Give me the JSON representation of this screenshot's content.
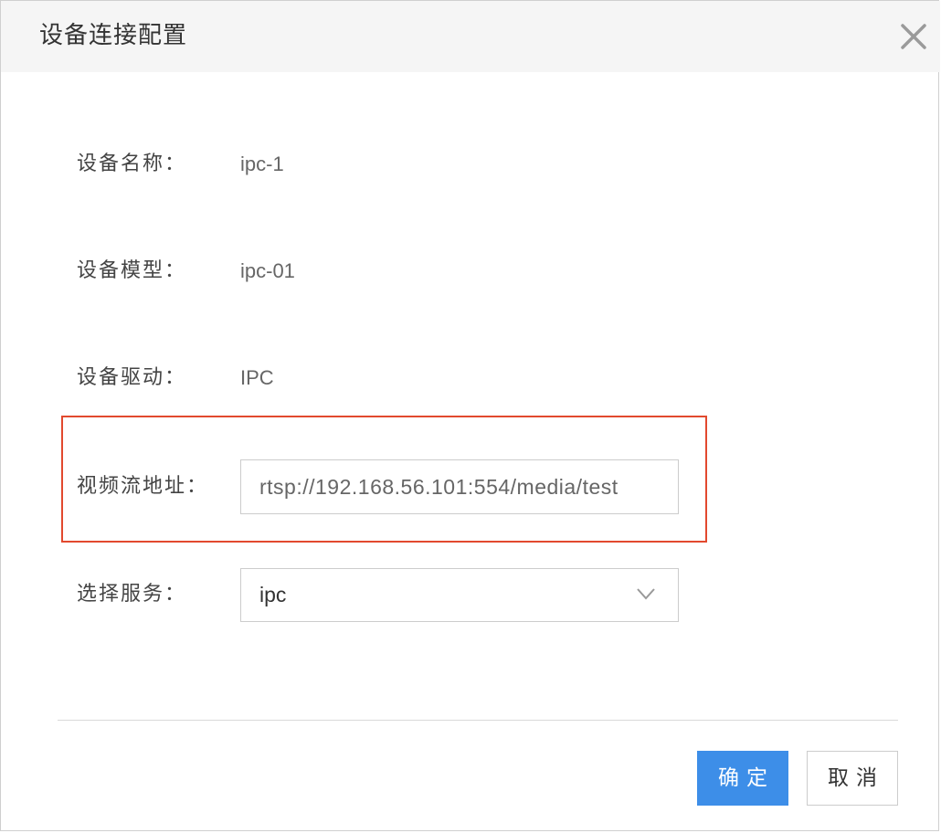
{
  "dialog": {
    "title": "设备连接配置",
    "close_icon": "close-icon"
  },
  "fields": {
    "device_name": {
      "label": "设备名称：",
      "value": "ipc-1"
    },
    "device_model": {
      "label": "设备模型：",
      "value": "ipc-01"
    },
    "device_driver": {
      "label": "设备驱动：",
      "value": "IPC"
    },
    "stream_url": {
      "label": "视频流地址：",
      "value": "rtsp://192.168.56.101:554/media/test"
    },
    "service": {
      "label": "选择服务：",
      "value": "ipc",
      "arrow_icon": "chevron-down-icon"
    }
  },
  "footer": {
    "confirm_label": "确定",
    "cancel_label": "取消"
  },
  "colors": {
    "primary": "#3d8ee8",
    "highlight": "#e2492e",
    "header_bg": "#f5f5f5"
  }
}
